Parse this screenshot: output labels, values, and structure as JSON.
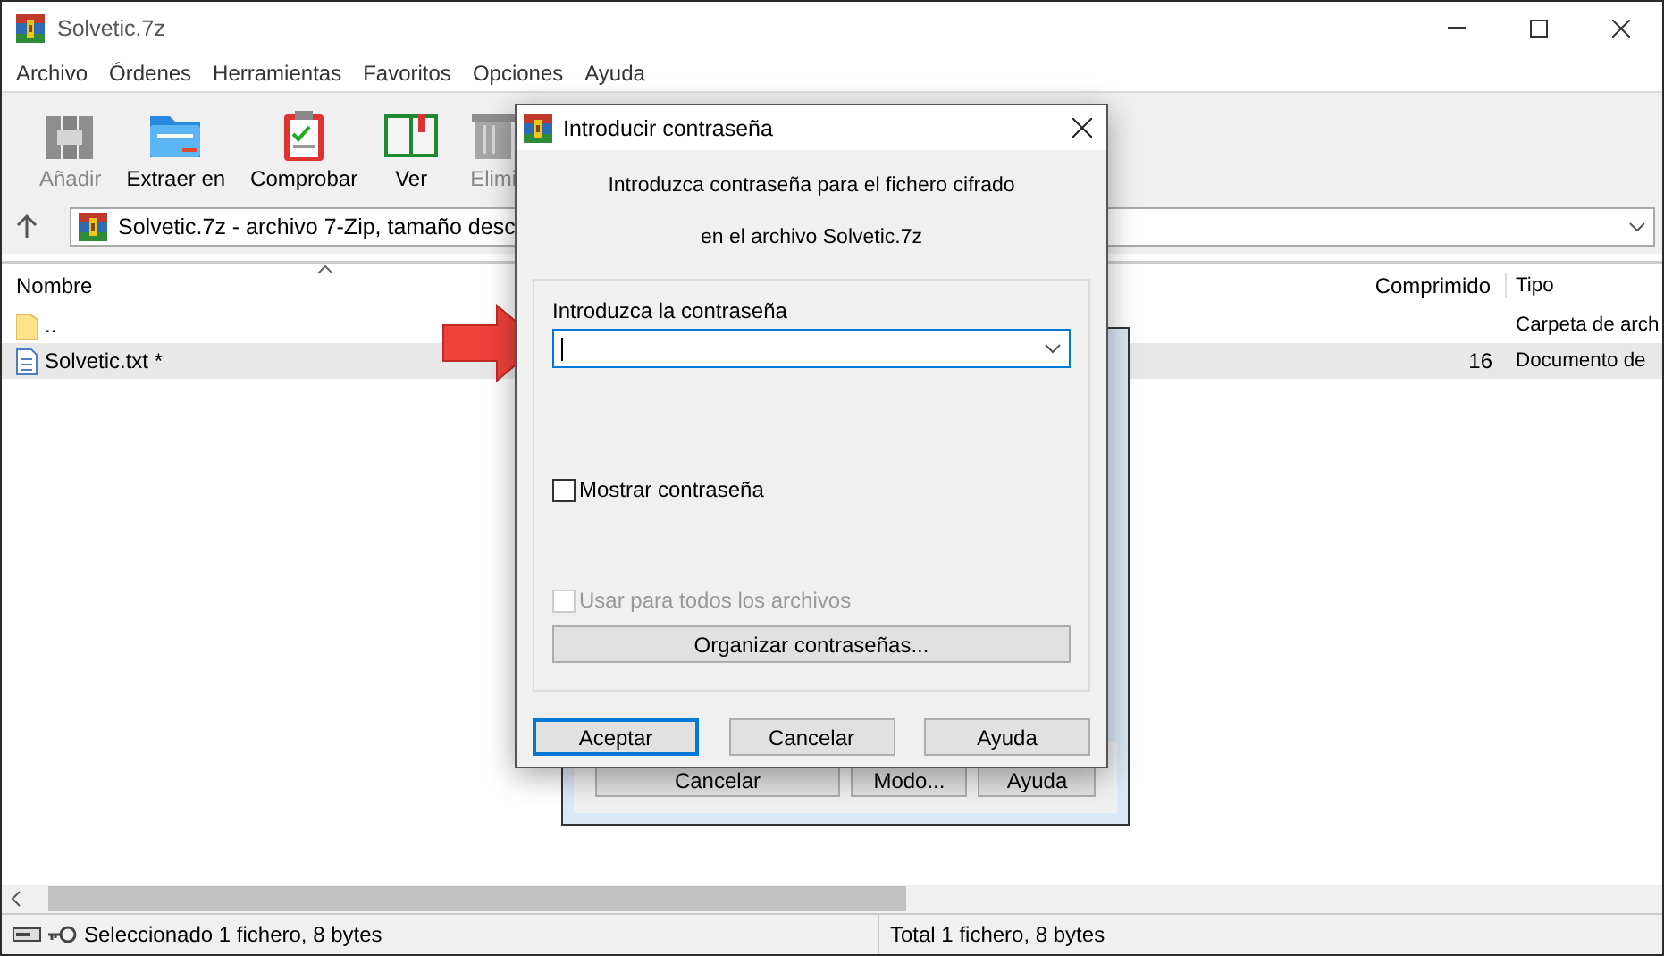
{
  "window": {
    "title": "Solvetic.7z"
  },
  "menu": [
    "Archivo",
    "Órdenes",
    "Herramientas",
    "Favoritos",
    "Opciones",
    "Ayuda"
  ],
  "toolbar": [
    {
      "label": "Añadir",
      "disabled": true
    },
    {
      "label": "Extraer en",
      "disabled": false
    },
    {
      "label": "Comprobar",
      "disabled": false
    },
    {
      "label": "Ver",
      "disabled": false
    },
    {
      "label": "Elimi",
      "disabled": true
    }
  ],
  "address": "Solvetic.7z - archivo 7-Zip, tamaño desc",
  "table": {
    "columns": [
      "Nombre",
      "Comprimido",
      "Tipo"
    ],
    "rows": [
      {
        "kind": "folder",
        "name": "..",
        "compressed": "",
        "type": "Carpeta de arch",
        "selected": false
      },
      {
        "kind": "file",
        "name": "Solvetic.txt *",
        "compressed": "16",
        "type": "Documento de",
        "selected": true
      }
    ]
  },
  "status_bar": [
    "Seleccionado 1 fichero, 8 bytes",
    "Total 1 fichero, 8 bytes"
  ],
  "back_dialog": {
    "buttons": [
      "Cancelar",
      "Modo...",
      "Ayuda"
    ]
  },
  "dialog": {
    "title": "Introducir contraseña",
    "message": [
      "Introduzca contraseña para el fichero cifrado",
      "en el archivo Solvetic.7z"
    ],
    "field_label": "Introduzca la contraseña",
    "checkboxes": [
      {
        "label": "Mostrar contraseña",
        "checked": false,
        "disabled": false
      },
      {
        "label": "Usar para todos los archivos",
        "checked": false,
        "disabled": true
      }
    ],
    "manage_button": "Organizar contraseñas...",
    "buttons": [
      {
        "label": "Aceptar",
        "selected": true
      },
      {
        "label": "Cancelar",
        "selected": false
      },
      {
        "label": "Ayuda",
        "selected": false
      }
    ]
  }
}
